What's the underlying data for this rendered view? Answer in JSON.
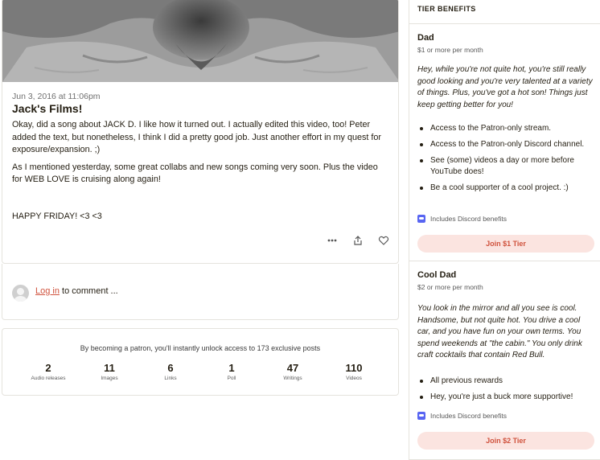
{
  "post": {
    "date": "Jun 3, 2016 at 11:06pm",
    "title": "Jack's Films!",
    "paragraphs": [
      "Okay, did a song about JACK D. I like how it turned out. I actually edited this video, too! Peter added the text, but nonetheless, I think I did a pretty good job. Just another effort in my quest for exposure/expansion. ;)",
      "As I mentioned yesterday, some great collabs and new songs coming very soon. Plus the video for WEB LOVE is cruising along again!",
      "HAPPY FRIDAY! <3 <3"
    ],
    "actions": {
      "more_icon": "ooo",
      "share_icon": "share-icon",
      "like_icon": "heart-icon"
    }
  },
  "comment": {
    "login_link": "Log in",
    "suffix": " to comment ..."
  },
  "stats": {
    "headline": "By becoming a patron, you'll instantly unlock access to 173 exclusive posts",
    "items": [
      {
        "num": "2",
        "label": "Audio releases"
      },
      {
        "num": "11",
        "label": "Images"
      },
      {
        "num": "6",
        "label": "Links"
      },
      {
        "num": "1",
        "label": "Poll"
      },
      {
        "num": "47",
        "label": "Writings"
      },
      {
        "num": "110",
        "label": "Videos"
      }
    ]
  },
  "tiers": {
    "header": "TIER BENEFITS",
    "list": [
      {
        "name": "Dad",
        "price": "$1 or more per month",
        "description": "Hey, while you're not quite hot, you're still really good looking and you're very talented at a variety of things. Plus, you've got a hot son! Things just keep getting better for you!",
        "benefits": [
          "Access to the Patron-only stream.",
          "Access to the Patron-only Discord channel.",
          "See (some) videos a day or more before YouTube does!",
          "Be a cool supporter of a cool project. :)"
        ],
        "discord": "Includes Discord benefits",
        "button": "Join $1 Tier"
      },
      {
        "name": "Cool Dad",
        "price": "$2 or more per month",
        "description": "You look in the mirror and all you see is cool. Handsome, but not quite hot. You drive a cool car, and you have fun on your own terms. You spend weekends at \"the cabin.\" You only drink craft cocktails that contain Red Bull.",
        "benefits": [
          "All previous rewards",
          "Hey, you're just a buck more supportive!"
        ],
        "discord": "Includes Discord benefits",
        "button": "Join $2 Tier"
      }
    ]
  },
  "colors": {
    "accent": "#d0533e",
    "button_bg": "#fbe4e0",
    "discord": "#5865f2",
    "border": "#e5e3dd"
  }
}
